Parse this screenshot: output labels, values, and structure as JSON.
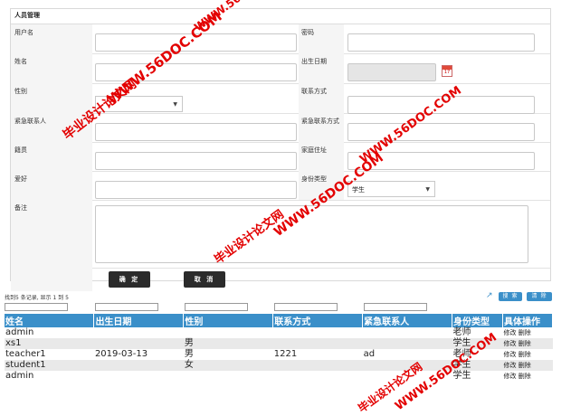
{
  "panel": {
    "title": "人员管理"
  },
  "form": {
    "username_label": "用户名",
    "password_label": "密码",
    "name_label": "姓名",
    "birth_label": "出生日期",
    "gender_label": "性别",
    "contact_label": "联系方式",
    "emergency_contact_label": "紧急联系人",
    "emergency_phone_label": "紧急联系方式",
    "origin_label": "籍贯",
    "address_label": "家庭住址",
    "hobby_label": "爱好",
    "identity_label": "身份类型",
    "identity_value": "学生",
    "remark_label": "备注",
    "confirm": "确 定",
    "cancel": "取 消",
    "calendar_day": "17"
  },
  "list": {
    "info": "找到5 条记录, 显示 1 到 5",
    "search": "搜 索",
    "clear": "清 除",
    "columns": [
      "姓名",
      "出生日期",
      "性别",
      "联系方式",
      "紧急联系人",
      "身份类型",
      "具体操作"
    ],
    "rows": [
      [
        "admin",
        "",
        "",
        "",
        "",
        "老师",
        "修改 删除"
      ],
      [
        "xs1",
        "",
        "男",
        "",
        "",
        "学生",
        "修改 删除"
      ],
      [
        "teacher1",
        "2019-03-13",
        "男",
        "1221",
        "ad",
        "老师",
        "修改 删除"
      ],
      [
        "student1",
        "",
        "女",
        "",
        "",
        "学生",
        "修改 删除"
      ],
      [
        "admin",
        "",
        "",
        "",
        "",
        "学生",
        "修改 删除"
      ]
    ]
  },
  "watermarks": {
    "w1": "WWW.56DOC.COM",
    "w2": "毕业设计论文网",
    "w3": "WWW.56DOC.COM",
    "w4": "毕业设计论文网",
    "w5": "WWW.56DOC.COM",
    "w6": "毕业设计论文网",
    "w7": "WWW.56DOC.COM",
    "w8": "WWW.56DOC.COM"
  },
  "colors": {
    "accent": "#3a8fc9",
    "button_dark": "#2b2b2b",
    "watermark": "#e30000"
  }
}
